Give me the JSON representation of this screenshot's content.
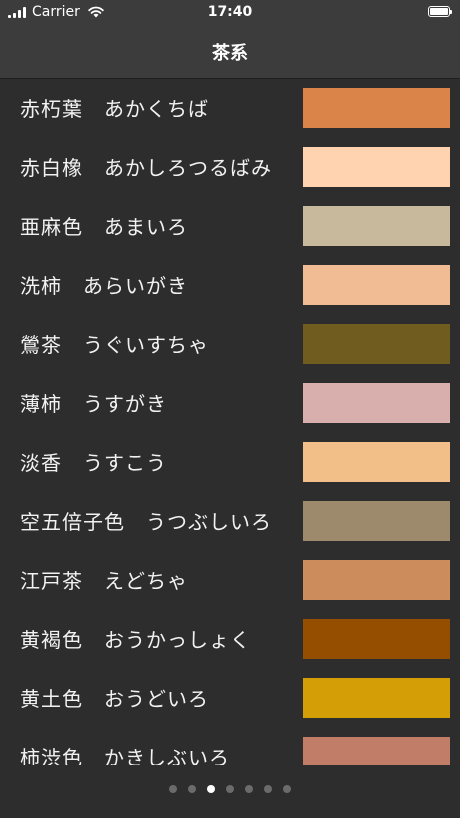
{
  "status": {
    "carrier": "Carrier",
    "time": "17:40"
  },
  "nav": {
    "title": "茶系"
  },
  "colors": [
    {
      "name": "赤朽葉",
      "reading": "あかくちば",
      "hex": "#db8449"
    },
    {
      "name": "赤白橡",
      "reading": "あかしろつるばみ",
      "hex": "#ffd3af"
    },
    {
      "name": "亜麻色",
      "reading": "あまいろ",
      "hex": "#c8b99c"
    },
    {
      "name": "洗柿",
      "reading": "あらいがき",
      "hex": "#f1bb93"
    },
    {
      "name": "鶯茶",
      "reading": "うぐいすちゃ",
      "hex": "#715c1f"
    },
    {
      "name": "薄柿",
      "reading": "うすがき",
      "hex": "#d8afad"
    },
    {
      "name": "淡香",
      "reading": "うすこう",
      "hex": "#f3bf88"
    },
    {
      "name": "空五倍子色",
      "reading": "うつぶしいろ",
      "hex": "#9d896c"
    },
    {
      "name": "江戸茶",
      "reading": "えどちゃ",
      "hex": "#cd8c5c"
    },
    {
      "name": "黄褐色",
      "reading": "おうかっしょく",
      "hex": "#954e00"
    },
    {
      "name": "黄土色",
      "reading": "おうどいろ",
      "hex": "#d49f06"
    },
    {
      "name": "柿渋色",
      "reading": "かきしぶいろ",
      "hex": "#c27d69"
    }
  ],
  "pager": {
    "count": 7,
    "active": 2
  }
}
